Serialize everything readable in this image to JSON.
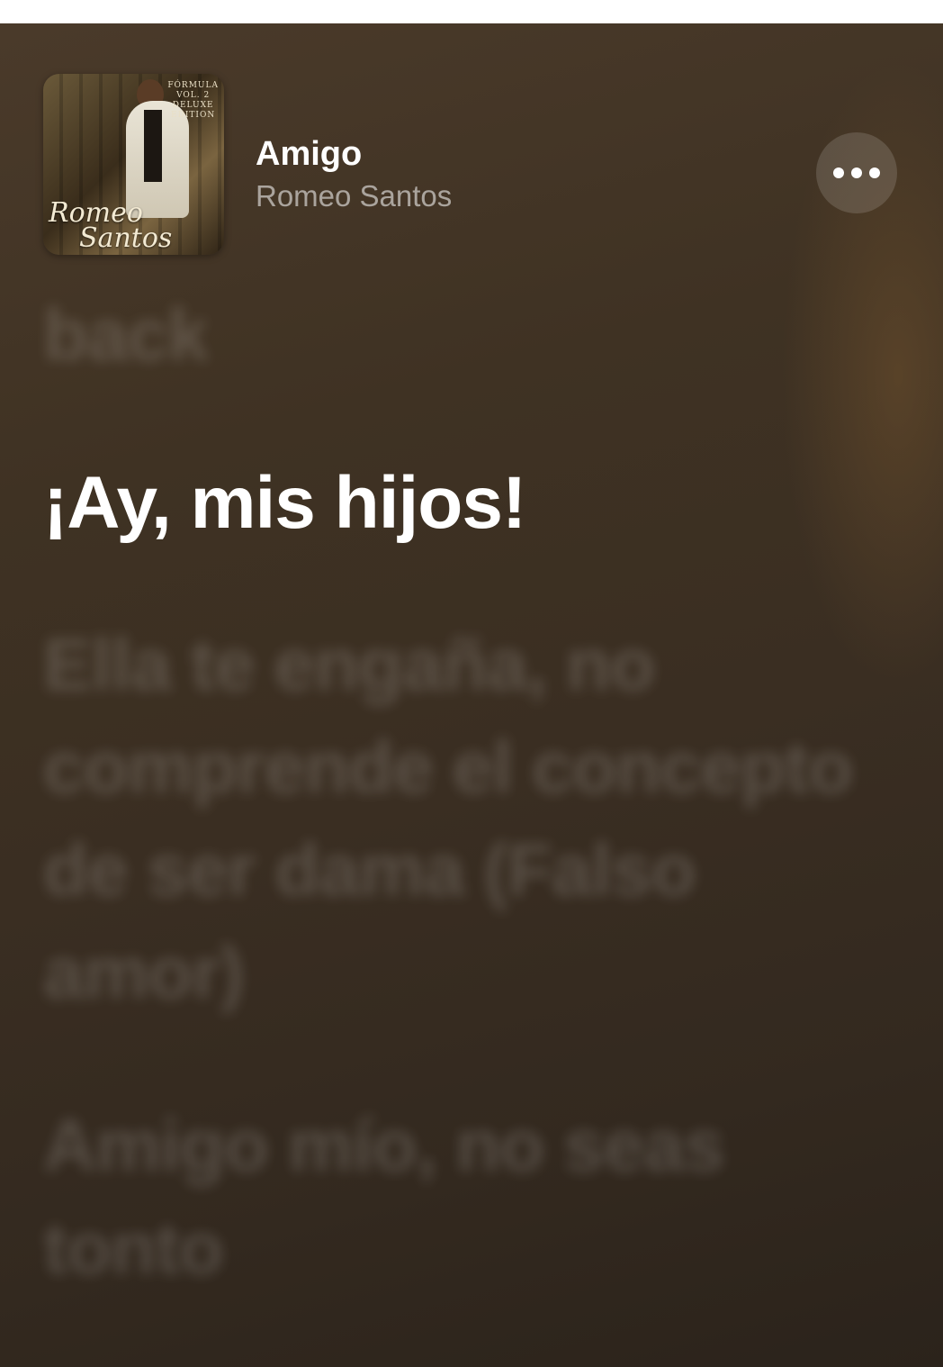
{
  "now_playing": {
    "title": "Amigo",
    "artist": "Romeo Santos",
    "cover_art": {
      "script_line_1": "Romeo",
      "script_line_2": "Santos",
      "badge_line_1": "FÓRMULA",
      "badge_line_2": "VOL. 2",
      "badge_line_3": "DELUXE",
      "badge_line_4": "EDITION"
    },
    "more_icon": "ellipsis-icon"
  },
  "lyrics": {
    "previous": "back",
    "current": "¡Ay, mis hijos!",
    "next_1": "Ella te engaña, no comprende el concepto de ser dama (Falso amor)",
    "next_2": "Amigo mío, no seas tonto"
  },
  "colors": {
    "background_top": "#4a3a2a",
    "background_bottom": "#2b231b",
    "active_lyric": "#ffffff",
    "dim_lyric": "rgba(255,255,255,0.16)"
  }
}
